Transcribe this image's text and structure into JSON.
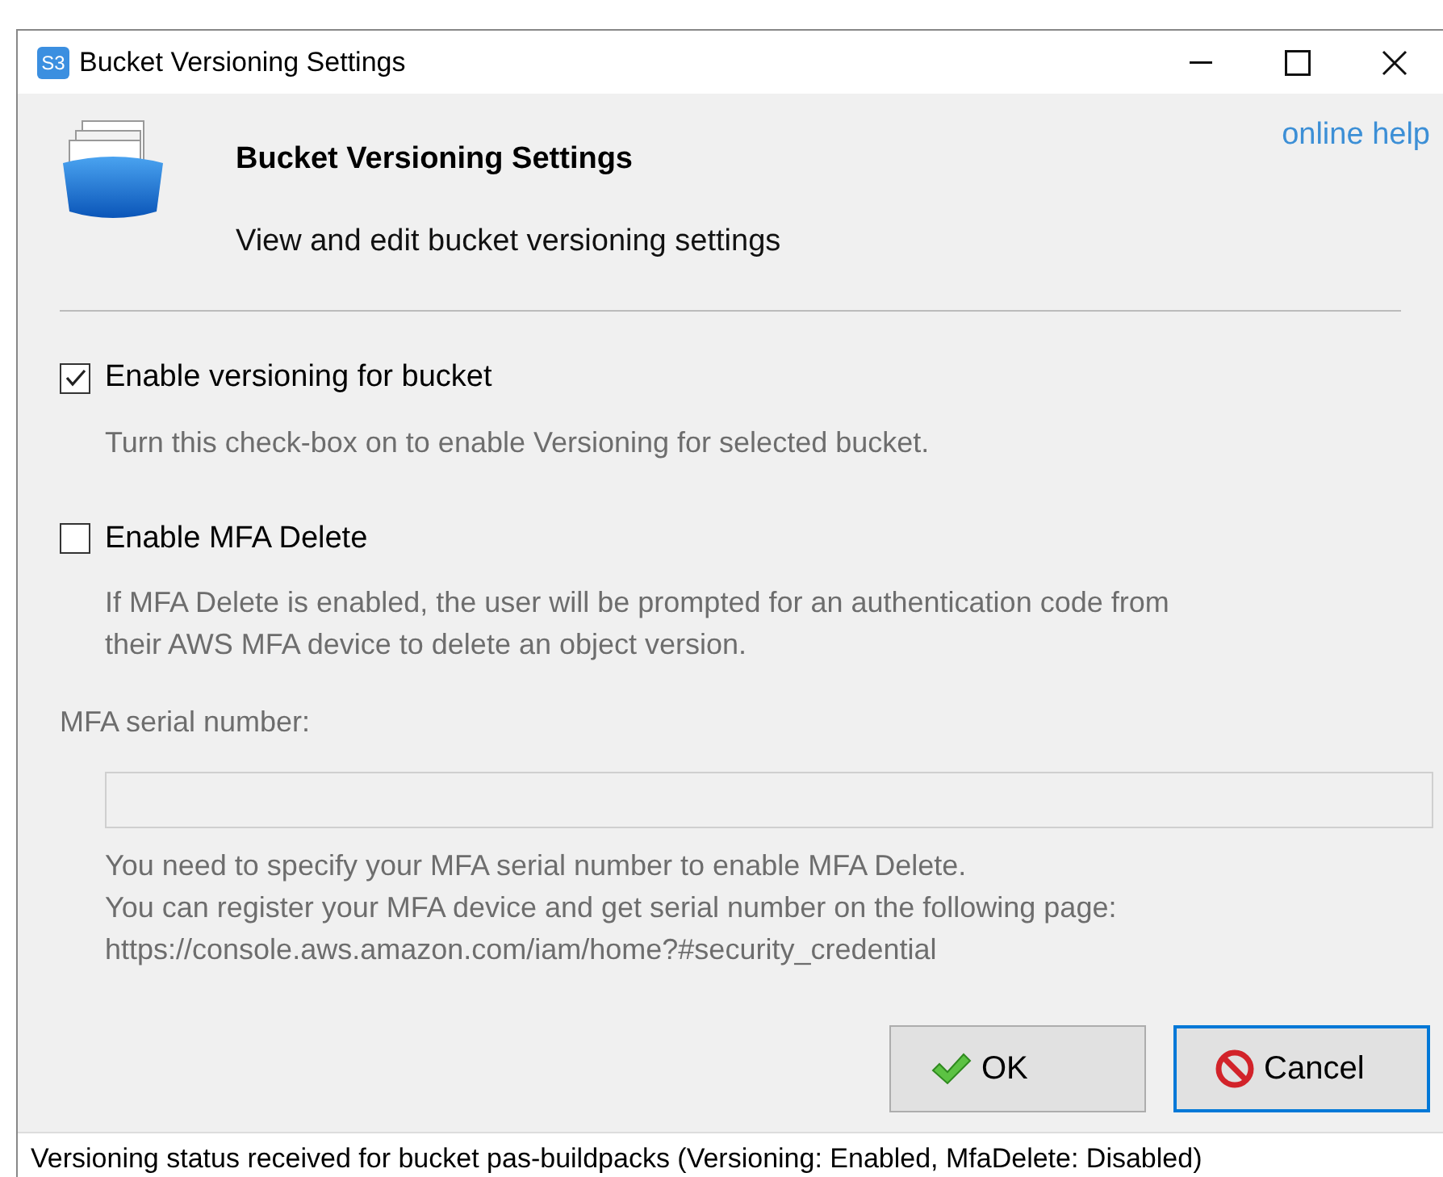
{
  "window": {
    "app_icon_text": "S3",
    "title": "Bucket Versioning Settings"
  },
  "header": {
    "title": "Bucket Versioning Settings",
    "subtitle": "View and edit bucket versioning settings",
    "help_link": "online help"
  },
  "options": [
    {
      "label": "Enable versioning for bucket",
      "checked": true,
      "hint": [
        "Turn this check-box on to enable Versioning for selected bucket."
      ]
    },
    {
      "label": "Enable MFA Delete",
      "checked": false,
      "hint": [
        "If MFA Delete is enabled, the user will be prompted for an authentication code from",
        "their AWS MFA device to delete an object version."
      ]
    }
  ],
  "serial": {
    "label": "MFA serial number:",
    "disabled": true,
    "help": [
      "You need to specify your MFA serial number to enable MFA Delete.",
      "You can register your MFA device and get serial number on the following page:",
      "https://console.aws.amazon.com/iam/home?#security_credential"
    ]
  },
  "buttons": [
    {
      "label": "OK",
      "kind": "ok",
      "default": false
    },
    {
      "label": "Cancel",
      "kind": "cancel",
      "default": true
    }
  ],
  "status_bar": "Versioning status received for bucket pas-buildpacks (Versioning: Enabled, MfaDelete: Disabled)"
}
